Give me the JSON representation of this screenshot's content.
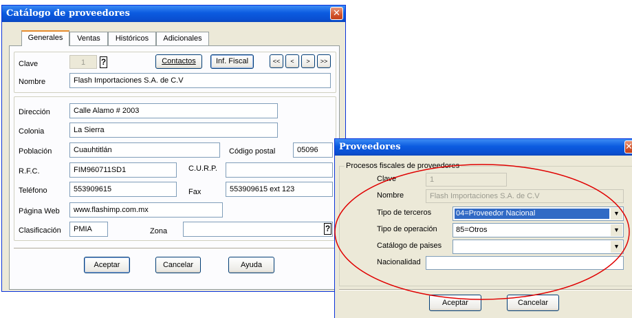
{
  "main_window": {
    "title": "Catálogo de proveedores",
    "close_glyph": "✕",
    "tabs": [
      {
        "label": "Generales",
        "active": true
      },
      {
        "label": "Ventas",
        "active": false
      },
      {
        "label": "Históricos",
        "active": false
      },
      {
        "label": "Adicionales",
        "active": false
      }
    ],
    "clave": {
      "label": "Clave",
      "value": "1",
      "lookup_glyph": "?"
    },
    "buttons": {
      "contactos": "Contactos",
      "inf_fiscal": "Inf. Fiscal",
      "first": "<<",
      "prev": "<",
      "next": ">",
      "last": ">>"
    },
    "nombre": {
      "label": "Nombre",
      "value": "Flash Importaciones S.A. de C.V"
    },
    "direccion": {
      "label": "Dirección",
      "value": "Calle Alamo # 2003"
    },
    "colonia": {
      "label": "Colonia",
      "value": "La Sierra"
    },
    "poblacion": {
      "label": "Población",
      "value": "Cuauhtitlán"
    },
    "codigo_postal": {
      "label": "Código postal",
      "value": "05096"
    },
    "rfc": {
      "label": "R.F.C.",
      "value": "FIM960711SD1"
    },
    "curp": {
      "label": "C.U.R.P.",
      "value": ""
    },
    "telefono": {
      "label": "Teléfono",
      "value": "553909615"
    },
    "fax": {
      "label": "Fax",
      "value": "553909615 ext 123"
    },
    "pagina_web": {
      "label": "Página Web",
      "value": "www.flashimp.com.mx"
    },
    "clasificacion": {
      "label": "Clasificación",
      "value": "PMIA"
    },
    "zona": {
      "label": "Zona",
      "value": "",
      "lookup_glyph": "?"
    },
    "footer": {
      "aceptar": "Aceptar",
      "cancelar": "Cancelar",
      "ayuda": "Ayuda"
    }
  },
  "fiscal_window": {
    "title": "Proveedores",
    "close_glyph": "✕",
    "group_title": "Procesos fiscales de proveedores",
    "clave": {
      "label": "Clave",
      "value": "1"
    },
    "nombre": {
      "label": "Nombre",
      "value": "Flash Importaciones S.A. de C.V"
    },
    "tipo_terceros": {
      "label": "Tipo de terceros",
      "value": "04=Proveedor Nacional"
    },
    "tipo_operacion": {
      "label": "Tipo de operación",
      "value": "85=Otros"
    },
    "catalogo_paises": {
      "label": "Catálogo de paises",
      "value": ""
    },
    "nacionalidad": {
      "label": "Nacionalidad",
      "value": ""
    },
    "footer": {
      "aceptar": "Aceptar",
      "cancelar": "Cancelar"
    },
    "dropdown_glyph": "▼"
  },
  "colors": {
    "title_blue": "#0b5be0",
    "window_face": "#ece9d8",
    "annotation_red": "#e00000",
    "selection_blue": "#316ac5"
  }
}
